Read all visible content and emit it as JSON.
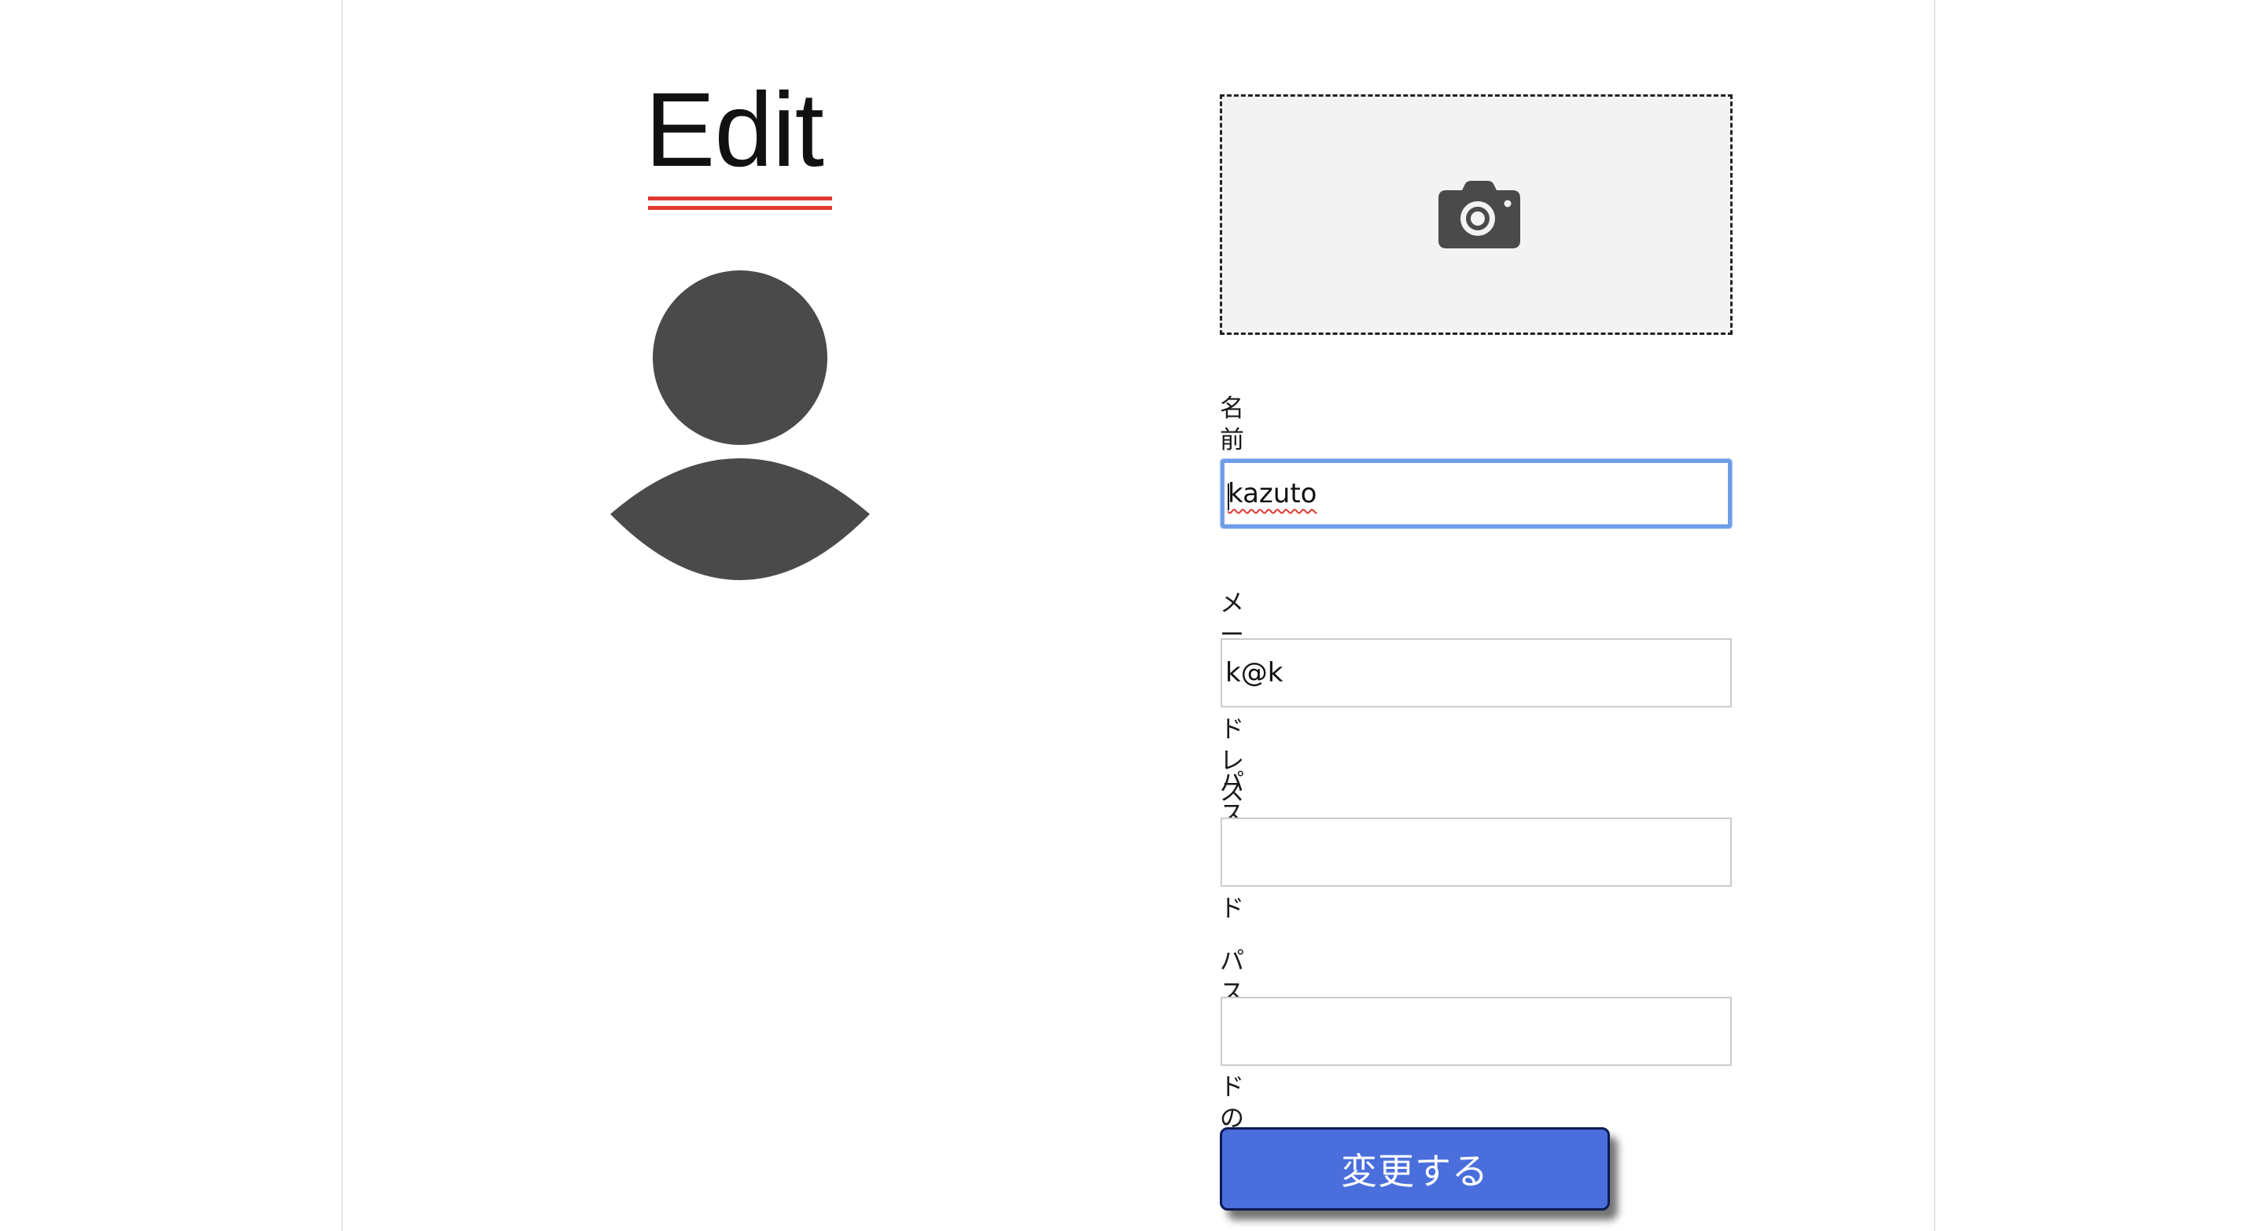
{
  "header": {
    "title": "Edit"
  },
  "colors": {
    "title_underline": "#e0392f",
    "avatar_fill": "#4a4a4a",
    "dropzone_background": "#f4f3f3",
    "focus_ring": "#6f9ee8",
    "button_background": "#4a6fdc",
    "button_border": "#0c1a55"
  },
  "avatar": {
    "icon": "user-silhouette-icon"
  },
  "image_upload": {
    "icon": "camera-icon"
  },
  "form": {
    "name": {
      "label": "名前",
      "value": "kazuto",
      "focused": true
    },
    "email": {
      "label": "メールアドレス",
      "value": "k@k"
    },
    "password": {
      "label": "パスワード",
      "value": ""
    },
    "password_confirmation": {
      "label": "パスワードの確認",
      "value": ""
    },
    "submit_label": "変更する"
  }
}
